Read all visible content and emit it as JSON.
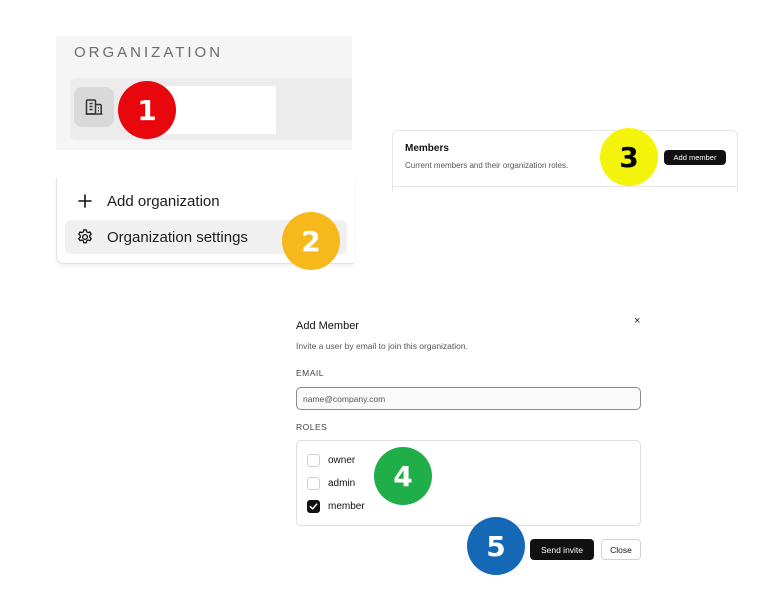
{
  "organization": {
    "heading": "ORGANIZATION",
    "icon": "building-icon"
  },
  "menu": {
    "add_label": "Add organization",
    "settings_label": "Organization settings"
  },
  "members": {
    "title": "Members",
    "subtitle": "Current members and their organization roles.",
    "add_button": "Add member"
  },
  "dialog": {
    "title": "Add Member",
    "close_glyph": "×",
    "description": "Invite a user by email to join this organization.",
    "email_label": "EMAIL",
    "email_placeholder": "name@company.com",
    "roles_label": "ROLES",
    "roles": [
      {
        "label": "owner",
        "checked": false
      },
      {
        "label": "admin",
        "checked": false
      },
      {
        "label": "member",
        "checked": true
      }
    ],
    "send_button": "Send invite",
    "close_button": "Close"
  },
  "markers": [
    "1",
    "2",
    "3",
    "4",
    "5"
  ],
  "colors": {
    "marker1": "#e8070d",
    "marker2": "#f7b81c",
    "marker3": "#f4f30a",
    "marker4": "#1fae47",
    "marker5": "#1468b6",
    "primary_button": "#111111"
  }
}
